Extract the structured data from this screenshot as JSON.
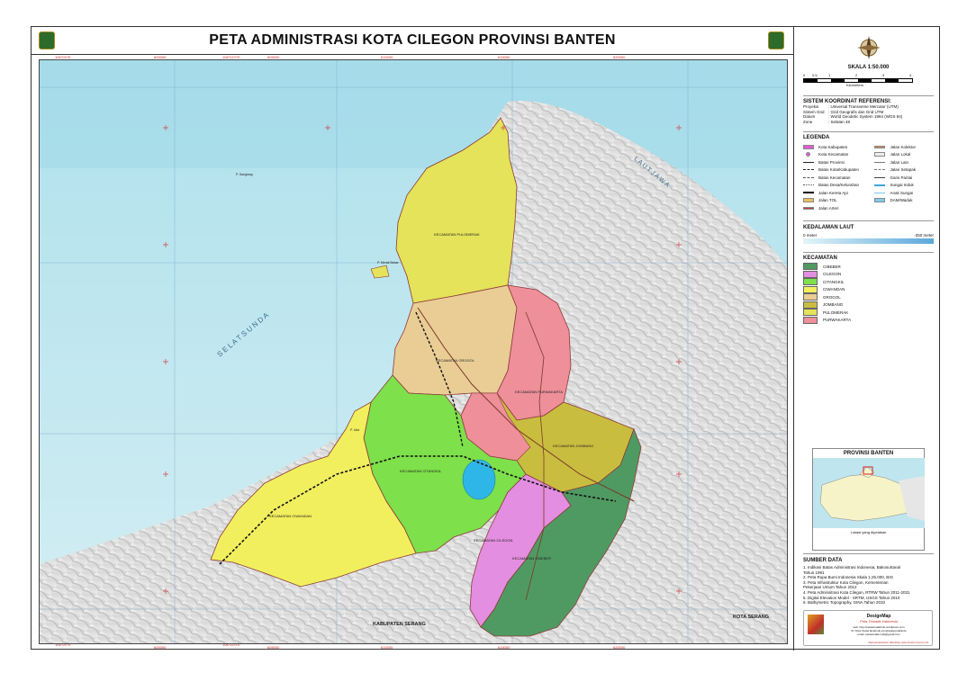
{
  "title": "PETA ADMINISTRASI KOTA CILEGON PROVINSI BANTEN",
  "grid": {
    "top_labels": [
      "106°0'0\"E",
      "600000",
      "106°02'0\"E",
      "605000",
      "610000",
      "106°04'0\"E",
      "615000",
      "106°06'0\"E",
      "620000",
      "106°08'0\"E"
    ],
    "bottom_labels": [
      "106°0'0\"E",
      "600000",
      "106°02'0\"E",
      "605000",
      "610000",
      "106°04'0\"E",
      "615000",
      "106°06'0\"E",
      "620000",
      "106°08'0\"E"
    ],
    "left_labels": [
      "6°0'0\"S",
      "9345000",
      "9340000",
      "6°02'0\"S",
      "9335000",
      "6°04'0\"S",
      "9330000",
      "6°06'0\"S",
      "9325000"
    ]
  },
  "map_labels": {
    "sea_west": "S E L A T   S U N D A",
    "sea_east": "L A U T   J A W A",
    "south_left": "KABUPATEN SERANG",
    "south_right": "KOTA SERANG",
    "districts": [
      "KECAMATAN PULOMERAK",
      "KECAMATAN GROGOL",
      "KECAMATAN PURWAKARTA",
      "KECAMATAN JOMBANG",
      "KECAMATAN CIWANDAN",
      "KECAMATAN CITANGKIL",
      "KECAMATAN CILEGON",
      "KECAMATAN CIBEBER"
    ],
    "islands": [
      "P. Sangiang",
      "P. Merak Besar",
      "P. Ular"
    ]
  },
  "scale": {
    "label": "SKALA 1:50.000",
    "ticks": [
      "0",
      "0.5",
      "1",
      "2",
      "3",
      "4"
    ],
    "unit": "Kilometers"
  },
  "coord": {
    "heading": "SISTEM KOORDINAT REFERENSI:",
    "rows": [
      {
        "k": "Proyeksi",
        "v": ": Universal Transverse Mercator (UTM)"
      },
      {
        "k": "Sistem Grid",
        "v": ": Grid Geografis dan Grid UTM"
      },
      {
        "k": "Datum",
        "v": ": World Geodetic System 1984 (WGS 84)"
      },
      {
        "k": "Zone",
        "v": ": Selatan 48"
      }
    ]
  },
  "legend": {
    "heading": "LEGENDA",
    "left": [
      "Kota Kabupaten",
      "Kota Kecamatan",
      "Batas Provinsi",
      "Batas Kota/Kabupaten",
      "Batas Kecamatan",
      "Batas Desa/Kelurahan",
      "Jalan Kereta Api",
      "Jalan TOL",
      "Jalan Arteri"
    ],
    "right": [
      "Jalan Kolektor",
      "Jalan Lokal",
      "Jalan Lain",
      "Jalan Setapak",
      "Garis Pantai",
      "Sungai Induk",
      "Anak Sungai",
      "DAM/Waduk"
    ]
  },
  "depth": {
    "heading": "KEDALAMAN LAUT",
    "min": "0 meter",
    "max": "-250 meter"
  },
  "kecamatan": {
    "heading": "KECAMATAN",
    "items": [
      {
        "name": "CIBEBER",
        "color": "#4f9a62"
      },
      {
        "name": "CILEGON",
        "color": "#e38ee0"
      },
      {
        "name": "CITANGKIL",
        "color": "#7ee04a"
      },
      {
        "name": "CIWANDAN",
        "color": "#f2ef5e"
      },
      {
        "name": "GROGOL",
        "color": "#e9cd95"
      },
      {
        "name": "JOMBANG",
        "color": "#c9bd3f"
      },
      {
        "name": "PULOMERAK",
        "color": "#e4e35a"
      },
      {
        "name": "PURWAKARTA",
        "color": "#ee8f9a"
      }
    ]
  },
  "inset": {
    "heading": "PROVINSI BANTEN",
    "caption": "Lokasi yang dipetakan"
  },
  "sources": {
    "heading": "SUMBER DATA",
    "items": [
      "1. Indikasi Batas Administrasi Indonesia, Bakosurtanal",
      "    Tahun 1991",
      "2. Peta Rupa Bumi Indonesia Skala 1:25.000, BIG",
      "3. Peta Infrastruktur Kota Cilegon, Kementerian",
      "    Pekerjaan Umum Tahun 2012",
      "4. Peta Adminsitrasi Kota Cilegon, RTRW Tahun 2011-2031",
      "5. Digital Elevation Model - SRTM, USGS Tahun 2010",
      "6. Bathymetric Topography, GINA Tahun 2010"
    ]
  },
  "credit": {
    "brand": "DesignMap",
    "tagline": "Peta Tematik Indonesia",
    "lines": [
      "web: http://petatematikindo.wordpress.com",
      "fb: https://www.facebook.com/petatematikindo",
      "email: petatematik.indo@gmail.com"
    ],
    "footer": "Manuskripsinkan diterakan peta berikut ukuran A3"
  },
  "colors": {
    "sea": "#bfe6ef",
    "sea_deep": "#9dd3e6",
    "land": "#e4e4e4",
    "border": "#9b3a3a"
  }
}
